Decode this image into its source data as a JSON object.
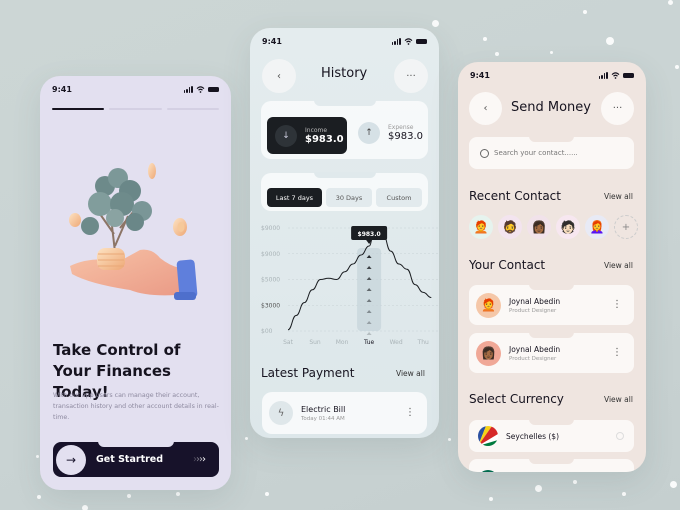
{
  "status_time": "9:41",
  "onboarding": {
    "progress_steps": 3,
    "active_step": 1,
    "title": "Take Control of Your Finances Today!",
    "description": "With our app users can manage their account, transaction history and other account details in real-time.",
    "cta_label": "Get Startred",
    "cta_arrows": "›››",
    "illustration": "hand-holding-money-tree-icon"
  },
  "history": {
    "title": "History",
    "back_icon": "chevron-left-icon",
    "menu_icon": "more-horizontal-icon",
    "income": {
      "label": "Income",
      "value": "$983.0",
      "icon": "arrow-down-icon"
    },
    "expense": {
      "label": "Expense",
      "value": "$983.0",
      "icon": "arrow-up-icon"
    },
    "filters": [
      {
        "label": "Last 7 days",
        "active": true
      },
      {
        "label": "30 Days",
        "active": false
      },
      {
        "label": "Custom",
        "active": false
      }
    ],
    "latest_payment_title": "Latest Payment",
    "view_all": "View all",
    "payment": {
      "name": "Electric Bill",
      "time": "Today 01:44 AM",
      "icon": "lightning-icon"
    }
  },
  "chart_data": {
    "type": "line",
    "categories": [
      "Sat",
      "Sun",
      "Mon",
      "Tue",
      "Wed",
      "Thu"
    ],
    "highlight_category": "Tue",
    "tooltip": "$983.0",
    "y_tick_labels": [
      "$9000",
      "$9000",
      "$5000",
      "$3000",
      "$00"
    ],
    "ylim": [
      0,
      4
    ],
    "series": [
      {
        "name": "History",
        "x": [
          0,
          0.3,
          0.6,
          0.9,
          1.2,
          1.5,
          1.8,
          2.1,
          2.4,
          2.7,
          3.0,
          3.2,
          3.5,
          3.8,
          4.1,
          4.4,
          4.7,
          5.0,
          5.3
        ],
        "y": [
          0.05,
          0.6,
          1.1,
          1.6,
          2.0,
          2.05,
          2.0,
          2.3,
          2.6,
          2.95,
          3.3,
          3.95,
          3.8,
          3.1,
          2.6,
          2.4,
          1.8,
          1.5,
          1.3
        ]
      }
    ],
    "grid": true,
    "title": "",
    "xlabel": "",
    "ylabel": ""
  },
  "send_money": {
    "title": "Send Money",
    "search_placeholder": "Search your contact......",
    "recent_title": "Recent Contact",
    "recent_view_all": "View all",
    "recent_avatars": [
      {
        "emoji": "🧑‍🦰",
        "bg": "#e6f3ee"
      },
      {
        "emoji": "🧔",
        "bg": "#f3e4ef"
      },
      {
        "emoji": "👩🏾",
        "bg": "#f1e2ea"
      },
      {
        "emoji": "🧑🏻",
        "bg": "#f7e7f0"
      },
      {
        "emoji": "👩‍🦰",
        "bg": "#e8eaf5"
      }
    ],
    "add_label": "+",
    "your_contact_title": "Your Contact",
    "your_contact_view_all": "View all",
    "contacts": [
      {
        "name": "Joynal Abedin",
        "role": "Product Designer",
        "emoji": "🧑‍🦰",
        "bg": "#f5c7a8"
      },
      {
        "name": "Joynal Abedin",
        "role": "Product Designer",
        "emoji": "👩🏾",
        "bg": "#f0a897"
      }
    ],
    "currency_title": "Select Currency",
    "currency_view_all": "View all",
    "currencies": [
      {
        "name": "Seychelles ($)",
        "selected": false
      },
      {
        "name": "",
        "selected": false
      }
    ]
  }
}
